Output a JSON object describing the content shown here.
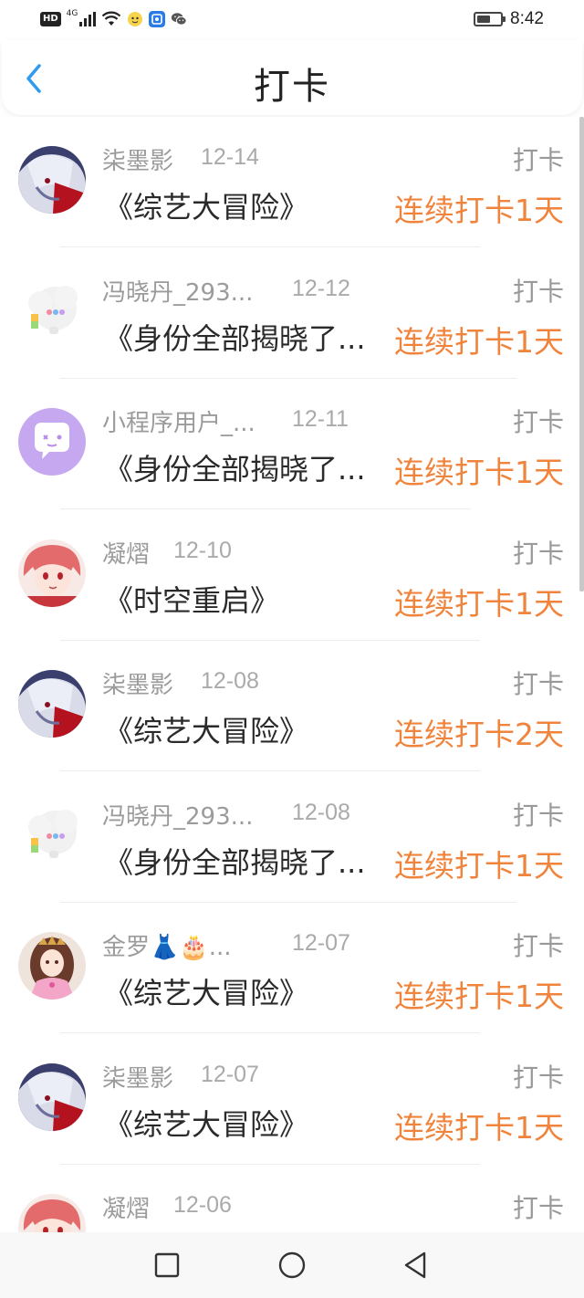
{
  "status_bar": {
    "hd_badge": "HD",
    "network": "4G",
    "time": "8:42",
    "battery_level": 0.6
  },
  "header": {
    "title": "打卡",
    "back_icon": "chevron-left-icon"
  },
  "list": {
    "items": [
      {
        "name": "柒墨影",
        "date": "12-14",
        "tag": "打卡",
        "title": "《综艺大冒险》",
        "streak": "连续打卡1天",
        "avatar": "avatar-dark-hair"
      },
      {
        "name": "冯晓丹_293...",
        "date": "12-12",
        "tag": "打卡",
        "title": "《身份全部揭晓了...",
        "streak": "连续打卡1天",
        "avatar": "avatar-cloud"
      },
      {
        "name": "小程序用户_...",
        "date": "12-11",
        "tag": "打卡",
        "title": "《身份全部揭晓了...",
        "streak": "连续打卡1天",
        "avatar": "avatar-chat-bubble"
      },
      {
        "name": "凝熠",
        "date": "12-10",
        "tag": "打卡",
        "title": "《时空重启》",
        "streak": "连续打卡1天",
        "avatar": "avatar-red-hair"
      },
      {
        "name": "柒墨影",
        "date": "12-08",
        "tag": "打卡",
        "title": "《综艺大冒险》",
        "streak": "连续打卡2天",
        "avatar": "avatar-dark-hair"
      },
      {
        "name": "冯晓丹_293...",
        "date": "12-08",
        "tag": "打卡",
        "title": "《身份全部揭晓了...",
        "streak": "连续打卡1天",
        "avatar": "avatar-cloud"
      },
      {
        "name": "金罗👗🎂...",
        "date": "12-07",
        "tag": "打卡",
        "title": "《综艺大冒险》",
        "streak": "连续打卡1天",
        "avatar": "avatar-princess"
      },
      {
        "name": "柒墨影",
        "date": "12-07",
        "tag": "打卡",
        "title": "《综艺大冒险》",
        "streak": "连续打卡1天",
        "avatar": "avatar-dark-hair"
      },
      {
        "name": "凝熠",
        "date": "12-06",
        "tag": "打卡",
        "title": "",
        "streak": "",
        "avatar": "avatar-red-hair"
      }
    ]
  },
  "nav_bar": {
    "buttons": [
      "recent-apps-icon",
      "home-icon",
      "back-triangle-icon"
    ]
  },
  "colors": {
    "streak": "#f0843c",
    "title_text": "#2a2a2a",
    "muted_text": "#9b9b9b",
    "accent_back": "#2f9bec"
  }
}
